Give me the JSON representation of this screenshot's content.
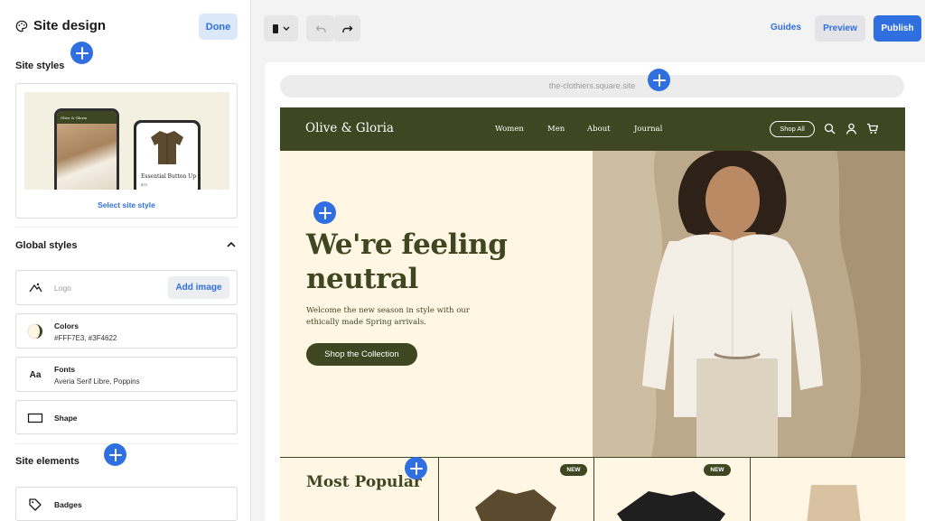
{
  "panel": {
    "title": "Site design",
    "done_label": "Done",
    "site_styles_heading": "Site styles",
    "select_site_style": "Select site style",
    "mock_brand": "Olive & Gloria",
    "mock_product_name": "Essential Button Up",
    "mock_product_price": "$75",
    "global_styles_heading": "Global styles",
    "logo_placeholder": "Logo",
    "add_image_label": "Add image",
    "colors_label": "Colors",
    "colors_value": "#FFF7E3, #3F4622",
    "fonts_label": "Fonts",
    "fonts_value": "Averia Serif Libre, Poppins",
    "shape_label": "Shape",
    "site_elements_heading": "Site elements",
    "badges_label": "Badges"
  },
  "toolbar": {
    "guides_label": "Guides",
    "preview_label": "Preview",
    "publish_label": "Publish"
  },
  "canvas": {
    "url": "the-clothiers.square.site"
  },
  "site": {
    "brand": "Olive & Gloria",
    "nav": [
      "Women",
      "Men",
      "About",
      "Journal"
    ],
    "shop_all": "Shop All",
    "hero_title": "We're feeling neutral",
    "hero_text": "Welcome the new season in style with our ethically made Spring arrivals.",
    "hero_button": "Shop the Collection",
    "most_popular": "Most Popular",
    "badge": "NEW"
  },
  "colors": {
    "accent": "#2f6fe0",
    "brand_dark": "#3F4622",
    "brand_light": "#FFF7E3"
  },
  "icons": [
    "palette-icon",
    "device-icon",
    "undo-icon",
    "redo-icon",
    "search-icon",
    "user-icon",
    "cart-icon",
    "chevron-up-icon",
    "logo-icon",
    "color-swatch-icon",
    "shape-icon",
    "tag-icon",
    "add-section-icon"
  ]
}
